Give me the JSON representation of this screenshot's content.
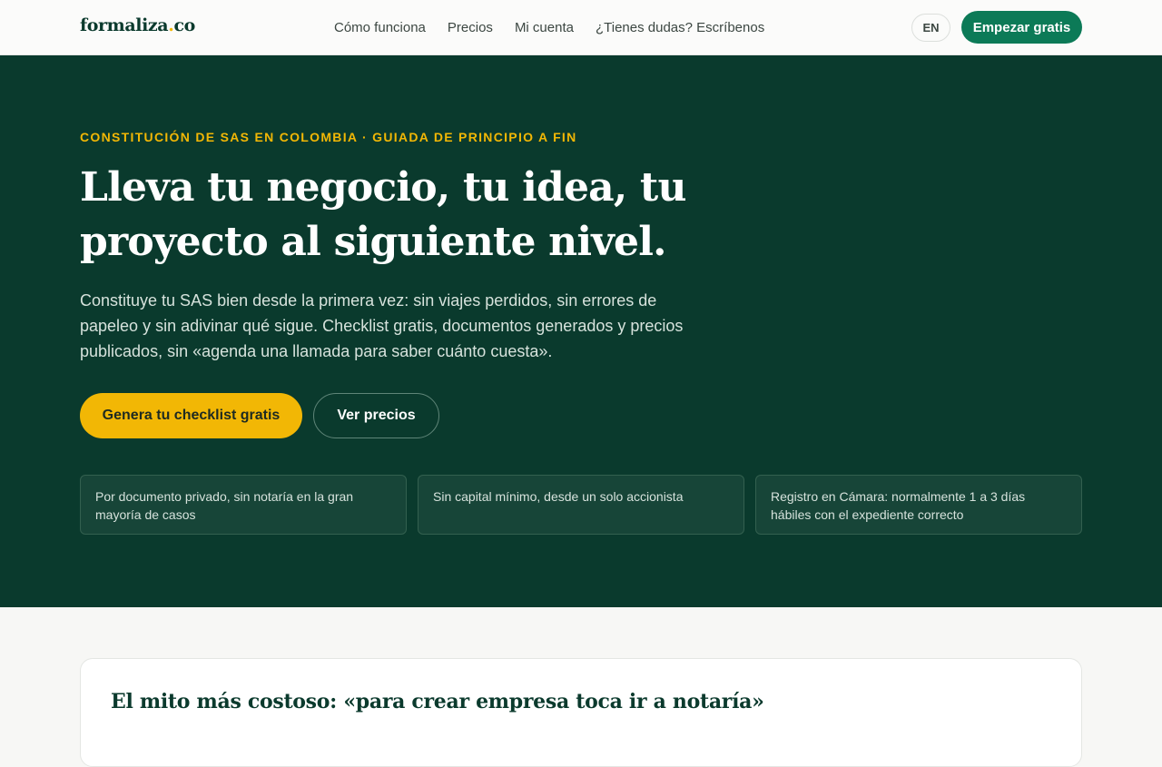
{
  "header": {
    "logo_text": "formaliza",
    "logo_dot": ".",
    "logo_tld": "co",
    "nav": [
      "Cómo funciona",
      "Precios",
      "Mi cuenta",
      "¿Tienes dudas? Escríbenos"
    ],
    "lang": "EN",
    "cta": "Empezar gratis"
  },
  "hero": {
    "eyebrow": "CONSTITUCIÓN DE SAS EN COLOMBIA · GUIADA DE PRINCIPIO A FIN",
    "headline": "Lleva tu negocio, tu idea, tu proyecto al siguiente nivel.",
    "lead": "Constituye tu SAS bien desde la primera vez: sin viajes perdidos, sin errores de papeleo y sin adivinar qué sigue. Checklist gratis, documentos generados y precios publicados, sin «agenda una llamada para saber cuánto cuesta».",
    "primary_cta": "Genera tu checklist gratis",
    "secondary_cta": "Ver precios",
    "features": [
      "Por documento privado, sin notaría en la gran mayoría de casos",
      "Sin capital mínimo, desde un solo accionista",
      "Registro en Cámara: normalmente 1 a 3 días hábiles con el expediente correcto"
    ]
  },
  "myth": {
    "title": "El mito más costoso: «para crear empresa toca ir a notaría»"
  },
  "colors": {
    "hero_bg": "#0a3a2d",
    "accent_yellow": "#f2b705",
    "brand_green": "#0c7a57"
  }
}
